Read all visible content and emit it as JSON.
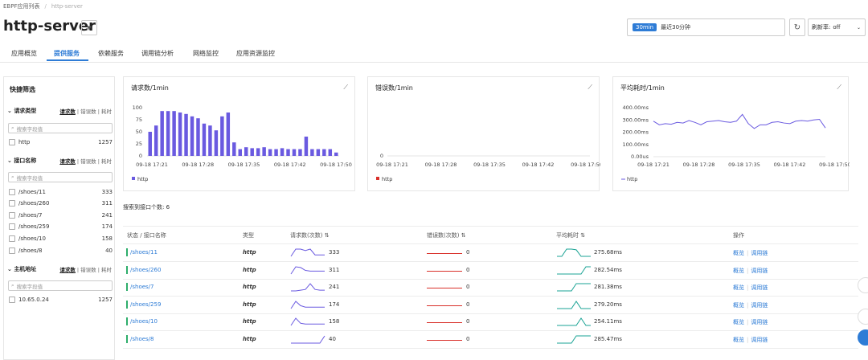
{
  "breadcrumb": {
    "root": "EBPF应用列表",
    "current": "http-server"
  },
  "page_title": "http-server",
  "time_range": {
    "badge": "30min",
    "label": "最近30分钟"
  },
  "refresh": {
    "label": "刷新率:",
    "value": "off"
  },
  "tabs": [
    "应用概览",
    "提供服务",
    "依赖服务",
    "调用链分析",
    "网络监控",
    "应用资源监控"
  ],
  "filter": {
    "title": "快捷筛选",
    "metric_tabs": {
      "a": "请求数",
      "b": "错误数",
      "c": "耗时"
    },
    "search_placeholder": "搜索字段值",
    "sections": [
      {
        "title": "请求类型",
        "items": [
          {
            "label": "http",
            "count": "1257"
          }
        ]
      },
      {
        "title": "接口名称",
        "items": [
          {
            "label": "/shoes/11",
            "count": "333"
          },
          {
            "label": "/shoes/260",
            "count": "311"
          },
          {
            "label": "/shoes/7",
            "count": "241"
          },
          {
            "label": "/shoes/259",
            "count": "174"
          },
          {
            "label": "/shoes/10",
            "count": "158"
          },
          {
            "label": "/shoes/8",
            "count": "40"
          }
        ]
      },
      {
        "title": "主机地址",
        "items": [
          {
            "label": "10.65.0.24",
            "count": "1257"
          }
        ]
      }
    ]
  },
  "charts_text": {
    "req": {
      "title": "请求数/1min",
      "legend": "http"
    },
    "err": {
      "title": "错误数/1min",
      "legend": "http"
    },
    "lat": {
      "title": "平均耗时/1min",
      "legend": "http"
    }
  },
  "chart_data": [
    {
      "type": "bar",
      "title": "请求数/1min",
      "x_ticks": [
        "09-18 17:21",
        "09-18 17:28",
        "09-18 17:35",
        "09-18 17:42",
        "09-18 17:50"
      ],
      "y_ticks": [
        "100",
        "75",
        "50",
        "25",
        "0"
      ],
      "ylim": [
        0,
        100
      ],
      "series": [
        {
          "name": "http",
          "color": "#6a5ae0",
          "values": [
            50,
            63,
            93,
            93,
            93,
            90,
            87,
            82,
            78,
            67,
            63,
            53,
            82,
            90,
            28,
            14,
            18,
            16,
            16,
            18,
            14,
            14,
            16,
            14,
            14,
            14,
            40,
            14,
            14,
            14,
            14,
            7
          ]
        }
      ]
    },
    {
      "type": "line",
      "title": "错误数/1min",
      "x_ticks": [
        "09-18 17:21",
        "09-18 17:28",
        "09-18 17:35",
        "09-18 17:42",
        "09-18 17:50"
      ],
      "y_ticks": [
        "0"
      ],
      "series": [
        {
          "name": "http",
          "color": "#d9302a",
          "values": []
        }
      ]
    },
    {
      "type": "line",
      "title": "平均耗时/1min",
      "x_ticks": [
        "09-18 17:21",
        "09-18 17:28",
        "09-18 17:35",
        "09-18 17:42",
        "09-18 17:50"
      ],
      "y_ticks": [
        "400.00ms",
        "300.00ms",
        "200.00ms",
        "100.00ms",
        "0.00us"
      ],
      "ylim": [
        0,
        400
      ],
      "series": [
        {
          "name": "http",
          "color": "#6a5ae0",
          "values": [
            290,
            260,
            270,
            265,
            280,
            275,
            295,
            280,
            260,
            285,
            290,
            295,
            285,
            280,
            290,
            345,
            270,
            230,
            260,
            260,
            280,
            285,
            275,
            270,
            290,
            295,
            290,
            300,
            305,
            235
          ]
        }
      ]
    }
  ],
  "result_label": "搜索到接口个数: 6",
  "table": {
    "headers": {
      "name": "状态 / 接口名称",
      "type": "类型",
      "req": "请求数(次数)",
      "err": "错误数(次数)",
      "lat": "平均耗时",
      "ops": "操作"
    },
    "sort_icon": "⇅",
    "rows": [
      {
        "name": "/shoes/11",
        "type": "http",
        "req": "333",
        "err": "0",
        "lat": "275.68ms",
        "spark_req": [
          0,
          1,
          1,
          0.8,
          1,
          0.2,
          0.2,
          0.2
        ],
        "spark_lat": [
          0,
          0,
          1,
          1,
          0.9,
          0,
          0,
          0
        ]
      },
      {
        "name": "/shoes/260",
        "type": "http",
        "req": "311",
        "err": "0",
        "lat": "282.54ms",
        "spark_req": [
          0,
          1,
          0.9,
          0.5,
          0.4,
          0.4,
          0.4,
          0.4
        ],
        "spark_lat": [
          0,
          0,
          0,
          0,
          0,
          0,
          1,
          1
        ]
      },
      {
        "name": "/shoes/7",
        "type": "http",
        "req": "241",
        "err": "0",
        "lat": "281.38ms",
        "spark_req": [
          0,
          0,
          0.1,
          0.2,
          1,
          0.2,
          0.1,
          0.1
        ],
        "spark_lat": [
          0,
          0,
          0,
          0,
          1,
          1,
          1,
          1
        ]
      },
      {
        "name": "/shoes/259",
        "type": "http",
        "req": "174",
        "err": "0",
        "lat": "279.20ms",
        "spark_req": [
          0,
          1,
          0.4,
          0.2,
          0.2,
          0.2,
          0.2,
          0.2
        ],
        "spark_lat": [
          0,
          0,
          0,
          0,
          1,
          0,
          0,
          0
        ]
      },
      {
        "name": "/shoes/10",
        "type": "http",
        "req": "158",
        "err": "0",
        "lat": "254.11ms",
        "spark_req": [
          0,
          1,
          0.3,
          0.2,
          0.2,
          0.2,
          0.2,
          0.2
        ],
        "spark_lat": [
          0,
          0,
          0,
          0,
          0,
          1,
          0,
          0
        ]
      },
      {
        "name": "/shoes/8",
        "type": "http",
        "req": "40",
        "err": "0",
        "lat": "285.47ms",
        "spark_req": [
          0,
          0,
          0,
          0,
          0,
          0,
          0,
          1
        ],
        "spark_lat": [
          0,
          0,
          0,
          0,
          1,
          1,
          1,
          1
        ]
      }
    ],
    "ops": {
      "overview": "概览",
      "trace": "调用链"
    }
  },
  "colors": {
    "accent": "#2e7cd6",
    "bar": "#6a5ae0",
    "error": "#d9302a",
    "latency": "#1aa394",
    "status_ok": "#2eae6b"
  }
}
